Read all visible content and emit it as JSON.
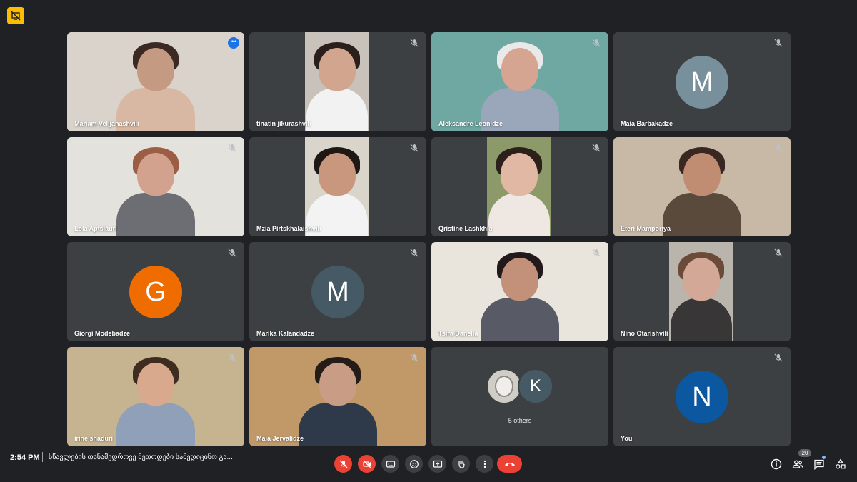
{
  "app": {
    "icon_name": "presentation-off-icon",
    "accent": "#fbbc04"
  },
  "tiles": [
    {
      "name": "Mariam Velijanashvili",
      "kind": "video",
      "active": true,
      "bg": "#d9d3cc",
      "skin": "#c49a83",
      "hair": "#3b2a24",
      "shirt": "#d8b8a2"
    },
    {
      "name": "tinatin jikurashvili",
      "kind": "video-narrow",
      "bg": "#c9c2bb",
      "skin": "#d1a58e",
      "hair": "#2a1f1b",
      "shirt": "#f2f2f2"
    },
    {
      "name": "Aleksandre Leonidze",
      "kind": "video",
      "bg": "#6fa7a2",
      "skin": "#d6a592",
      "hair": "#e9e9e9",
      "shirt": "#9aa7bb"
    },
    {
      "name": "Maia Barbakadze",
      "kind": "avatar",
      "letter": "M",
      "color": "#78909c"
    },
    {
      "name": "Lola Aptsiauri",
      "kind": "video",
      "bg": "#e4e2dd",
      "skin": "#d2a28f",
      "hair": "#9b5e44",
      "shirt": "#6d6e74"
    },
    {
      "name": "Mzia Pirtskhalaishvili",
      "kind": "video-narrow",
      "bg": "#dad5cb",
      "skin": "#c9977d",
      "hair": "#1f1714",
      "shirt": "#f3f3f3"
    },
    {
      "name": "Qristine Lashkhia",
      "kind": "video-narrow",
      "bg": "#8c9a6a",
      "skin": "#e0b8a3",
      "hair": "#2c201a",
      "shirt": "#efe8e2"
    },
    {
      "name": "Eteri Mamporiya",
      "kind": "video",
      "bg": "#c8b9a6",
      "skin": "#c08d72",
      "hair": "#3a2722",
      "shirt": "#5a4a3c"
    },
    {
      "name": "Giorgi Modebadze",
      "kind": "avatar",
      "letter": "G",
      "color": "#ef6c00"
    },
    {
      "name": "Marika Kalandadze",
      "kind": "avatar",
      "letter": "M",
      "color": "#455a64"
    },
    {
      "name": "Tsira Danelia",
      "kind": "video",
      "bg": "#e9e4dc",
      "skin": "#c3917a",
      "hair": "#23191b",
      "shirt": "#585b66"
    },
    {
      "name": "Nino Otarishvili",
      "kind": "video-narrow",
      "bg": "#b9b4ac",
      "skin": "#d4a896",
      "hair": "#6b4a3a",
      "shirt": "#383637"
    },
    {
      "name": "irine shaduri",
      "kind": "video",
      "bg": "#c6b38f",
      "skin": "#d9a98e",
      "hair": "#3f2c20",
      "shirt": "#8fa0b8"
    },
    {
      "name": "Maia Jervalidze",
      "kind": "video",
      "bg": "#c19867",
      "skin": "#c99d85",
      "hair": "#251c18",
      "shirt": "#2e3a4a"
    },
    {
      "name": "",
      "kind": "others",
      "letter": "K",
      "label": "5 others",
      "color": "#455a64"
    },
    {
      "name": "You",
      "kind": "avatar",
      "letter": "N",
      "color": "#0b57a0"
    }
  ],
  "footer": {
    "time": "2:54 PM",
    "meeting_title": "სწავლების თანამედროვე მეთოდები სამედიცინო გა...",
    "participants_count": "20",
    "controls": [
      {
        "name": "mic-off-icon",
        "style": "red"
      },
      {
        "name": "camera-off-icon",
        "style": "red"
      },
      {
        "name": "captions-icon",
        "style": "gray"
      },
      {
        "name": "emoji-icon",
        "style": "gray"
      },
      {
        "name": "present-icon",
        "style": "gray"
      },
      {
        "name": "raise-hand-icon",
        "style": "gray"
      },
      {
        "name": "more-options-icon",
        "style": "gray"
      },
      {
        "name": "end-call-icon",
        "style": "end"
      }
    ],
    "right_icons": [
      "info-icon",
      "people-icon",
      "chat-icon",
      "activities-icon"
    ]
  }
}
